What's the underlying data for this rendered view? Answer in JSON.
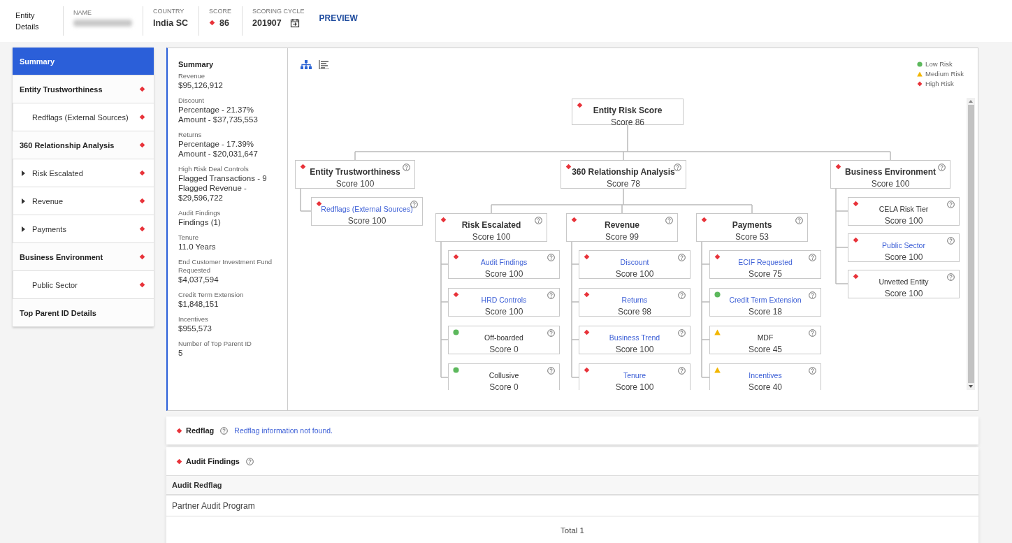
{
  "header": {
    "title": "Entity Details",
    "fields": [
      {
        "label": "NAME",
        "redacted": true
      },
      {
        "label": "COUNTRY",
        "value": "India SC"
      },
      {
        "label": "SCORE",
        "value": "86",
        "color": "#e8333a"
      },
      {
        "label": "SCORING CYCLE",
        "value": "201907",
        "kind": "date"
      }
    ],
    "preview": "PREVIEW"
  },
  "sidebar": {
    "items": [
      {
        "label": "Summary",
        "selected": true
      },
      {
        "label": "Entity Trustworthiness",
        "selected": false,
        "color": "#e8333a",
        "children": [
          {
            "label": "Redflags (External Sources)",
            "selected": false,
            "color": "#e8333a"
          }
        ]
      },
      {
        "label": "360 Relationship Analysis",
        "selected": false,
        "color": "#e8333a",
        "children": [
          {
            "label": "Risk Escalated",
            "selected": false,
            "color": "#e8333a",
            "expanded": false
          },
          {
            "label": "Revenue",
            "selected": false,
            "color": "#e8333a",
            "expanded": false
          },
          {
            "label": "Payments",
            "selected": false,
            "color": "#e8333a",
            "expanded": false
          }
        ]
      },
      {
        "label": "Business Environment",
        "selected": false,
        "color": "#e8333a",
        "children": [
          {
            "label": "Public Sector",
            "selected": false,
            "color": "#e8333a"
          }
        ]
      },
      {
        "label": "Top Parent ID Details",
        "selected": false
      }
    ]
  },
  "summary": {
    "title": "Summary",
    "items": [
      {
        "label": "Revenue",
        "values": [
          "$95,126,912"
        ]
      },
      {
        "label": "Discount",
        "values": [
          "Percentage - 21.37%",
          "Amount - $37,735,553"
        ]
      },
      {
        "label": "Returns",
        "values": [
          "Percentage - 17.39%",
          "Amount - $20,031,647"
        ]
      },
      {
        "label": "High Risk Deal Controls",
        "values": [
          "Flagged Transactions - 9",
          "Flagged Revenue - $29,596,722"
        ]
      },
      {
        "label": "Audit Findings",
        "values": [
          "Findings (1)"
        ]
      },
      {
        "label": "Tenure",
        "values": [
          "11.0 Years"
        ]
      },
      {
        "label": "End Customer Investment Fund Requested",
        "values": [
          "$4,037,594"
        ]
      },
      {
        "label": "Credit Term Extension",
        "values": [
          "$1,848,151"
        ]
      },
      {
        "label": "Incentives",
        "values": [
          "$955,573"
        ]
      },
      {
        "label": "Number of Top Parent ID",
        "values": [
          "5"
        ]
      }
    ]
  },
  "view_buttons": [
    {
      "kind": "tree",
      "selected": true
    },
    {
      "kind": "list",
      "selected": false
    }
  ],
  "legend": [
    {
      "color": "#5cb85c",
      "label": "Low Risk"
    },
    {
      "color": "#f2b600",
      "label": "Medium Risk"
    },
    {
      "color": "#e8333a",
      "label": "High Risk"
    }
  ],
  "tree": {
    "title": "Entity Risk Score",
    "score": "Score 86",
    "color": "#e8333a",
    "kind": "heading",
    "help": false,
    "children": [
      {
        "title": "Entity Trustworthiness",
        "score": "Score 100",
        "color": "#e8333a",
        "kind": "heading",
        "help": true,
        "children": [
          {
            "title": "Redflags (External Sources)",
            "score": "Score 100",
            "color": "#e8333a",
            "kind": "link",
            "help": true
          }
        ]
      },
      {
        "title": "360 Relationship Analysis",
        "score": "Score 78",
        "color": "#e8333a",
        "kind": "heading",
        "help": true,
        "children": [
          {
            "title": "Risk Escalated",
            "score": "Score 100",
            "color": "#e8333a",
            "kind": "heading",
            "help": true,
            "children": [
              {
                "title": "Audit Findings",
                "score": "Score 100",
                "color": "#e8333a",
                "kind": "link",
                "help": true
              },
              {
                "title": "HRD Controls",
                "score": "Score 100",
                "color": "#e8333a",
                "kind": "link",
                "help": true
              },
              {
                "title": "Off-boarded",
                "score": "Score 0",
                "color": "#5cb85c",
                "kind": "text",
                "help": true
              },
              {
                "title": "Collusive",
                "score": "Score 0",
                "color": "#5cb85c",
                "kind": "text",
                "help": true
              }
            ]
          },
          {
            "title": "Revenue",
            "score": "Score 99",
            "color": "#e8333a",
            "kind": "heading",
            "help": true,
            "children": [
              {
                "title": "Discount",
                "score": "Score 100",
                "color": "#e8333a",
                "kind": "link",
                "help": true
              },
              {
                "title": "Returns",
                "score": "Score 98",
                "color": "#e8333a",
                "kind": "link",
                "help": true
              },
              {
                "title": "Business Trend",
                "score": "Score 100",
                "color": "#e8333a",
                "kind": "link",
                "help": true
              },
              {
                "title": "Tenure",
                "score": "Score 100",
                "color": "#e8333a",
                "kind": "link",
                "help": true
              }
            ]
          },
          {
            "title": "Payments",
            "score": "Score 53",
            "color": "#e8333a",
            "kind": "heading",
            "help": true,
            "children": [
              {
                "title": "ECIF Requested",
                "score": "Score 75",
                "color": "#e8333a",
                "kind": "link",
                "help": true
              },
              {
                "title": "Credit Term Extension",
                "score": "Score 18",
                "color": "#5cb85c",
                "kind": "link",
                "help": true
              },
              {
                "title": "MDF",
                "score": "Score 45",
                "color": "#f2b600",
                "kind": "text",
                "help": true
              },
              {
                "title": "Incentives",
                "score": "Score 40",
                "color": "#f2b600",
                "kind": "link",
                "help": true
              }
            ]
          }
        ]
      },
      {
        "title": "Business Environment",
        "score": "Score 100",
        "color": "#e8333a",
        "kind": "heading",
        "help": true,
        "children": [
          {
            "title": "CELA Risk Tier",
            "score": "Score 100",
            "color": "#e8333a",
            "kind": "text",
            "help": true
          },
          {
            "title": "Public Sector",
            "score": "Score 100",
            "color": "#e8333a",
            "kind": "link",
            "help": true
          },
          {
            "title": "Unvetted Entity",
            "score": "Score 100",
            "color": "#e8333a",
            "kind": "text",
            "help": true
          }
        ]
      }
    ]
  },
  "redflag": {
    "title": "Redflag",
    "color": "#e8333a",
    "help": true,
    "message": "Redflag information not found."
  },
  "audit_findings": {
    "title": "Audit Findings",
    "color": "#e8333a",
    "help": true,
    "table": {
      "columns": [
        "Audit Redflag"
      ],
      "rows": [
        [
          "Partner Audit Program"
        ]
      ],
      "total": "Total 1"
    }
  }
}
